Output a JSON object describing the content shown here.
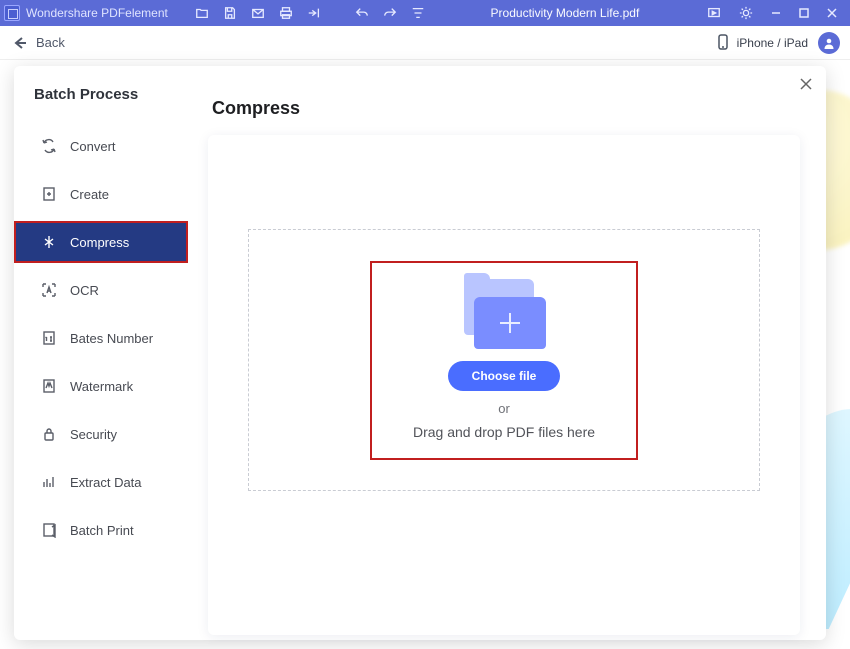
{
  "titlebar": {
    "app_name": "Wondershare PDFelement",
    "document_title": "Productivity Modern Life.pdf"
  },
  "subheader": {
    "back_label": "Back",
    "device_label": "iPhone / iPad"
  },
  "sidebar": {
    "title": "Batch Process",
    "items": [
      {
        "label": "Convert"
      },
      {
        "label": "Create"
      },
      {
        "label": "Compress"
      },
      {
        "label": "OCR"
      },
      {
        "label": "Bates Number"
      },
      {
        "label": "Watermark"
      },
      {
        "label": "Security"
      },
      {
        "label": "Extract Data"
      },
      {
        "label": "Batch Print"
      }
    ]
  },
  "main": {
    "title": "Compress",
    "choose_file_label": "Choose file",
    "or_label": "or",
    "drop_hint": "Drag and drop PDF files here"
  },
  "colors": {
    "primary": "#5b6bd6",
    "sidebar_active_bg": "#243a83",
    "highlight_border": "#c11f1f",
    "choose_btn_bg": "#4a6dff"
  }
}
